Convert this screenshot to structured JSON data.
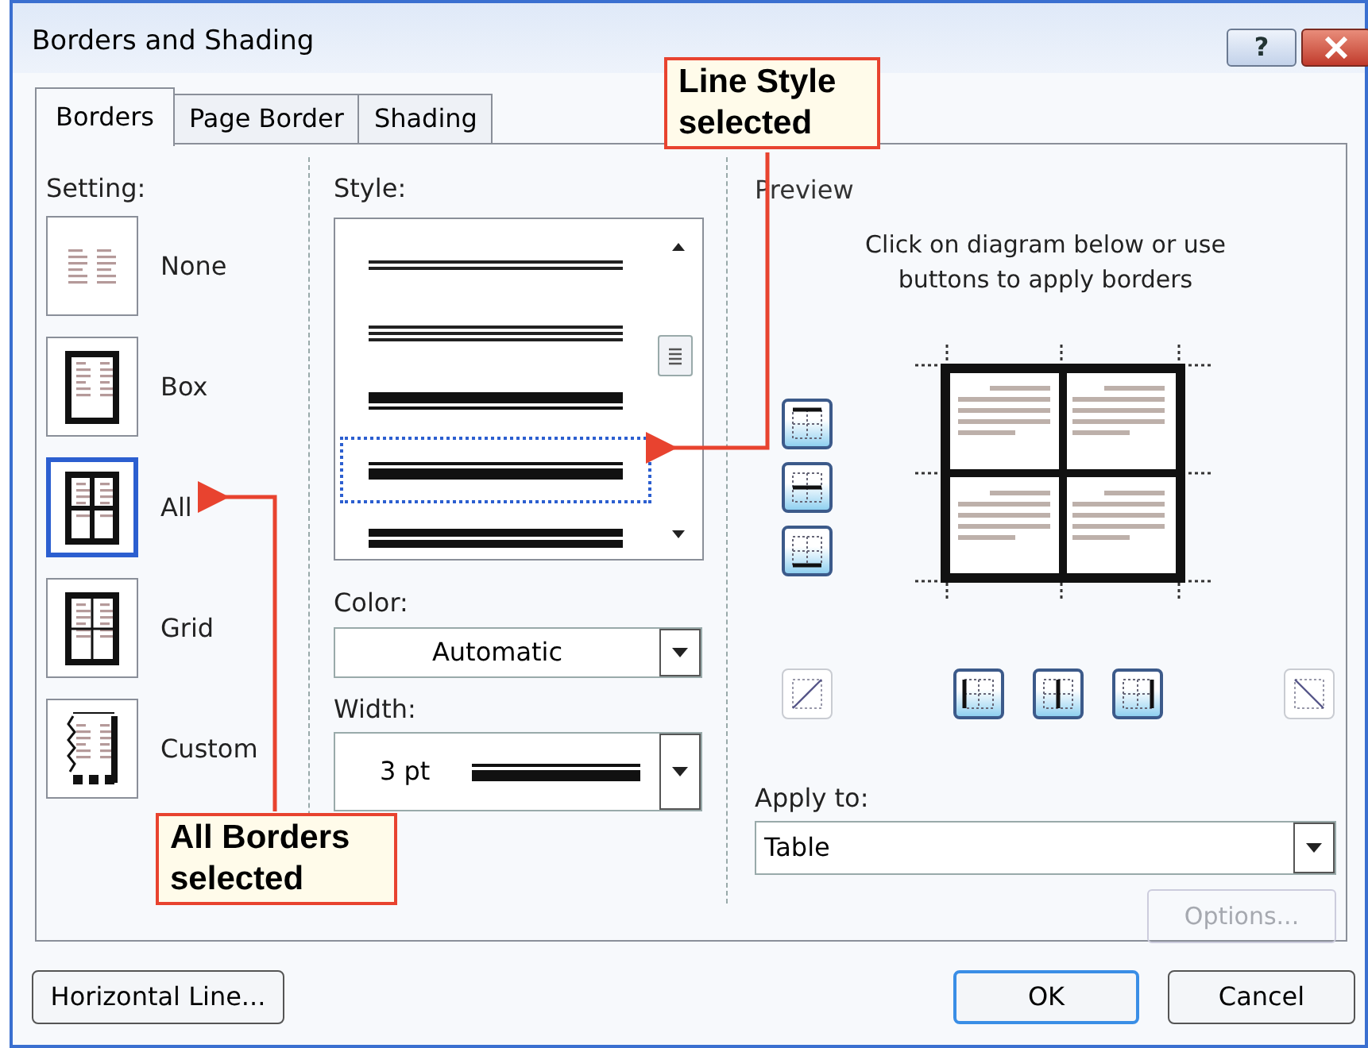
{
  "window": {
    "title": "Borders and Shading",
    "help_button": "?"
  },
  "tabs": [
    {
      "label": "Borders",
      "selected": true
    },
    {
      "label": "Page Border",
      "selected": false
    },
    {
      "label": "Shading",
      "selected": false
    }
  ],
  "setting": {
    "label": "Setting:",
    "items": [
      {
        "kind": "none",
        "label": "None",
        "selected": false
      },
      {
        "kind": "box",
        "label": "Box",
        "selected": false
      },
      {
        "kind": "all",
        "label": "All",
        "selected": true
      },
      {
        "kind": "grid",
        "label": "Grid",
        "selected": false
      },
      {
        "kind": "custom",
        "label": "Custom",
        "selected": false
      }
    ]
  },
  "style": {
    "label": "Style:",
    "items": [
      {
        "kind": "double",
        "selected": false
      },
      {
        "kind": "triple",
        "selected": false
      },
      {
        "kind": "thick-thin",
        "selected": false
      },
      {
        "kind": "thin-thick",
        "selected": true
      },
      {
        "kind": "thick-thick",
        "selected": false
      }
    ]
  },
  "color": {
    "label": "Color:",
    "value": "Automatic"
  },
  "width": {
    "label": "Width:",
    "value": "3 pt"
  },
  "preview": {
    "label": "Preview",
    "hint": "Click on diagram below or use buttons to apply borders",
    "side_buttons": [
      {
        "kind": "top",
        "on": true
      },
      {
        "kind": "middle-h",
        "on": true
      },
      {
        "kind": "bottom",
        "on": true
      }
    ],
    "bottom_buttons": [
      {
        "kind": "diag-up",
        "on": false
      },
      {
        "kind": "left",
        "on": true
      },
      {
        "kind": "middle-v",
        "on": true
      },
      {
        "kind": "right",
        "on": true
      },
      {
        "kind": "diag-down",
        "on": false
      }
    ]
  },
  "apply_to": {
    "label": "Apply to:",
    "value": "Table"
  },
  "options_button": {
    "label": "Options...",
    "disabled": true
  },
  "buttons": [
    {
      "kind": "horizontal",
      "label": "Horizontal Line...",
      "default": false
    },
    {
      "kind": "ok",
      "label": "OK",
      "default": true
    },
    {
      "kind": "cancel",
      "label": "Cancel",
      "default": false
    }
  ],
  "callouts": [
    {
      "kind": "style",
      "text": "Line Style selected"
    },
    {
      "kind": "setting",
      "text": "All Borders selected"
    }
  ]
}
